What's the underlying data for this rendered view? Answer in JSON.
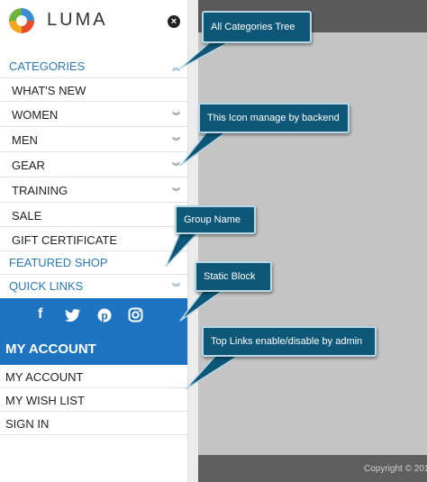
{
  "logo": {
    "text": "LUMA",
    "icon": "luma-logo"
  },
  "close_icon": "×",
  "categories": {
    "label": "CATEGORIES",
    "items": [
      {
        "label": "WHAT'S NEW",
        "has_children": false
      },
      {
        "label": "WOMEN",
        "has_children": true
      },
      {
        "label": "MEN",
        "has_children": true
      },
      {
        "label": "GEAR",
        "has_children": true
      },
      {
        "label": "TRAINING",
        "has_children": true
      },
      {
        "label": "SALE",
        "has_children": false
      },
      {
        "label": "GIFT CERTIFICATE",
        "has_children": false
      }
    ]
  },
  "featured_shop": {
    "label": "FEATURED SHOP"
  },
  "quick_links": {
    "label": "QUICK LINKS"
  },
  "social": [
    "f",
    "twitter",
    "p",
    "instagram"
  ],
  "account": {
    "header": "MY ACCOUNT",
    "links": [
      "MY ACCOUNT",
      "MY WISH LIST",
      "SIGN IN"
    ]
  },
  "footer": {
    "copyright": "Copyright © 201"
  },
  "callouts": [
    "All Categories Tree",
    "This Icon manage by backend",
    "Group Name",
    "Static Block",
    "Top Links enable/disable by admin"
  ],
  "colors": {
    "accent": "#1f74c2",
    "link": "#2a7ab8",
    "callout": "#0f5778"
  }
}
